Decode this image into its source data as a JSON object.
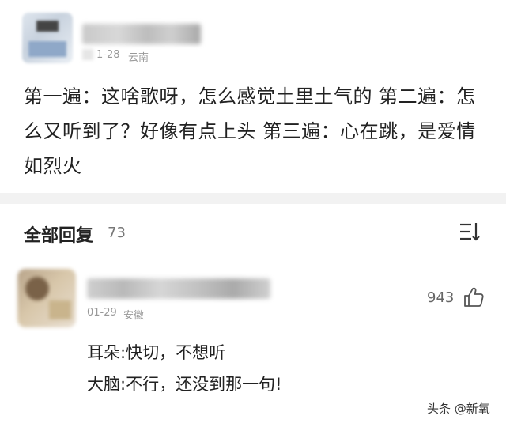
{
  "post": {
    "date": "1-28",
    "location": "云南",
    "text": "第一遍：这啥歌呀，怎么感觉土里土气的   第二遍：怎么又听到了？好像有点上头  第三遍：心在跳，是爱情如烈火"
  },
  "replies": {
    "title": "全部回复",
    "count": "73"
  },
  "reply": {
    "date": "01-29",
    "location": "安徽",
    "likes": "943",
    "line1": "耳朵:快切，不想听",
    "line2": "大脑:不行，还没到那一句!"
  },
  "watermark": "头条 @新氧"
}
